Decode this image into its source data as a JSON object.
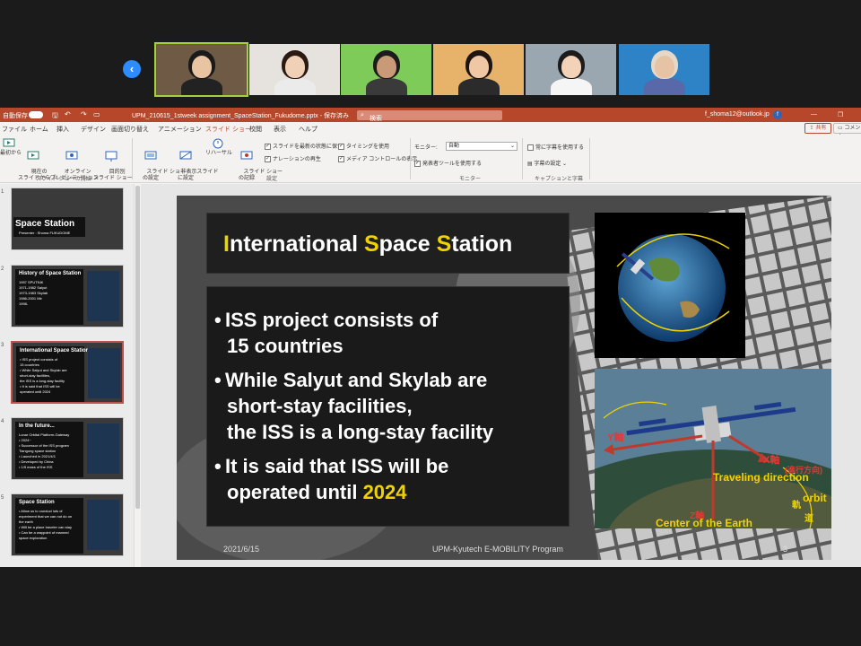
{
  "gallery": {
    "prev_arrow": "‹",
    "participants": [
      {
        "name": "participant-1",
        "bg": "#6e5a45",
        "skin": "#e8c4a3",
        "hair": "#1a1a1a",
        "shirt": "#222222"
      },
      {
        "name": "participant-2",
        "bg": "#e6e2de",
        "skin": "#f0d0b6",
        "hair": "#2a1a12",
        "shirt": "#ebebeb"
      },
      {
        "name": "participant-3",
        "bg": "#7ecb59",
        "skin": "#c89a78",
        "hair": "#1c1c1c",
        "shirt": "#3a3a3a"
      },
      {
        "name": "participant-4",
        "bg": "#e7b36b",
        "skin": "#efc7a4",
        "hair": "#1e1410",
        "shirt": "#2b2b2b"
      },
      {
        "name": "participant-5",
        "bg": "#9aa6b0",
        "skin": "#f2d2b8",
        "hair": "#1c1c1c",
        "shirt": "#f5f5f5"
      },
      {
        "name": "participant-6",
        "bg": "#2e83c6",
        "skin": "#e6c3a4",
        "hair": "#e4d8c8",
        "shirt": "#5868a8"
      }
    ]
  },
  "titlebar": {
    "autosave": "自動保存",
    "autosave_state": "オフ",
    "filename": "UPM_210615_1stweek assignment_SpaceStation_Fukudome.pptx - 保存済み",
    "search_placeholder": "検索",
    "user_email": "f_shoma12@outlook.jp"
  },
  "menu": {
    "tabs": [
      "ファイル",
      "ホーム",
      "挿入",
      "デザイン",
      "画面切り替え",
      "アニメーション",
      "スライド ショー",
      "校閲",
      "表示",
      "ヘルプ"
    ],
    "selected": "スライド ショー",
    "share": "共有",
    "comment": "コメント"
  },
  "ribbon": {
    "from_start": "最初から",
    "from_current": "現在の\nスライドから",
    "online": "オンライン\nプレゼンテーション",
    "custom": "目的別\nスライド ショー",
    "group1": "スライド ショーの開始",
    "setup": "スライド ショー\nの設定",
    "hide": "非表示スライド\nに設定",
    "rehearse": "リハーサル",
    "record": "スライド ショー\nの記録",
    "keep_fresh": "スライドを最新の状態に保つ",
    "narration": "ナレーションの再生",
    "timing": "タイミングを使用",
    "media": "メディア コントロールの表示",
    "group2": "設定",
    "monitor_label": "モニター:",
    "monitor_value": "自動",
    "presenter_view": "発表者ツールを使用する",
    "group3": "モニター",
    "always_subtitles": "常に字幕を使用する",
    "subtitle_settings": "字幕の設定",
    "group4": "キャプションと字幕"
  },
  "thumbnails": [
    {
      "num": "1",
      "title": "Space Station",
      "lines": [
        "Presenter : Shoma FUKUDOME"
      ]
    },
    {
      "num": "2",
      "title": "History of Space Station",
      "lines": [
        "1957   SPUTNIK",
        "1971-1982   Salyut",
        "1973-1983   Skylab",
        "1986-2001   Mir",
        "1998-"
      ]
    },
    {
      "num": "3",
      "title": "International Space Station",
      "lines": [
        "• ISS project consists of",
        "  15 countries",
        "• While Salyut and Skylab are",
        "  short-stay facilities,",
        "  the ISS is a long-stay facility",
        "• It is said that ISS will be",
        "  operated until 2024"
      ]
    },
    {
      "num": "4",
      "title": "In the future...",
      "lines": [
        "Lunar Orbital Platform-Gateway",
        "• 2024~",
        "• Successor of the ISS program",
        "Tiangong space station",
        "• Launched in 2021/4/1",
        "• Developed by China",
        "• 1/5 mass of the ISS"
      ]
    },
    {
      "num": "5",
      "title": "Space Station",
      "lines": [
        "• Allow us to conduct lots of",
        "  experiment that we can not do on",
        "  the earth",
        "• Will be a place traveler can stay",
        "• Can be a waypoint of manned",
        "  space exploration"
      ]
    }
  ],
  "slide": {
    "title_parts": [
      {
        "text": "I",
        "accent": true
      },
      {
        "text": "nternational ",
        "accent": false
      },
      {
        "text": "S",
        "accent": true
      },
      {
        "text": "pace ",
        "accent": false
      },
      {
        "text": "S",
        "accent": true
      },
      {
        "text": "tation",
        "accent": false
      }
    ],
    "bullet1_line1": "ISS project consists of",
    "bullet1_line2": "15 countries",
    "bullet2_line1": "While Salyut and Skylab are",
    "bullet2_line2": "short-stay facilities,",
    "bullet2_line3": "the ISS is a long-stay facility",
    "bullet3_line1": "It is said that ISS will be",
    "bullet3_line2_prefix": "operated until ",
    "bullet3_line2_year": "2024",
    "diagram": {
      "y_axis": "Y軸",
      "x_axis": "X軸",
      "x_sub": "(進行方向)",
      "traveling": "Traveling direction",
      "orbit": "orbit",
      "orbit_jp1": "軌",
      "orbit_jp2": "道",
      "z_axis": "Z軸",
      "center": "Center of the Earth"
    },
    "footer_date": "2021/6/15",
    "footer_center": "UPM-Kyutech E-MOBILITY Program",
    "slide_number": "3"
  },
  "colors": {
    "accent_yellow": "#f0d200",
    "ppt_red": "#b7472a",
    "zoom_blue": "#2d8cff"
  }
}
